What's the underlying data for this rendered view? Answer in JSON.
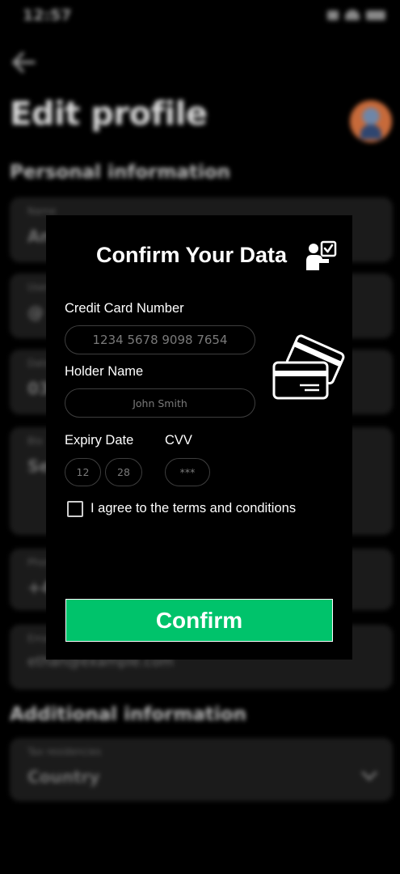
{
  "background": {
    "status_time": "12:57",
    "page_title": "Edit profile",
    "personal_section": "Personal information",
    "fields": [
      {
        "label": "Name",
        "value": "An"
      },
      {
        "label": "Username",
        "value": "@"
      },
      {
        "label": "Date",
        "value": "03"
      },
      {
        "label": "Bio",
        "value": "Se"
      },
      {
        "label": "Phone",
        "value": "+4"
      },
      {
        "label": "Email",
        "value": "ethan@example.com"
      }
    ],
    "additional_section": "Additional information",
    "tax_field": {
      "label": "Tax residencies",
      "value": "Country"
    }
  },
  "modal": {
    "title": "Confirm Your Data",
    "card_number": {
      "label": "Credit Card Number",
      "placeholder": "1234 5678 9098 7654"
    },
    "holder": {
      "label": "Holder Name",
      "placeholder": "John Smith"
    },
    "expiry": {
      "label": "Expiry Date",
      "month": "12",
      "year": "28"
    },
    "cvv": {
      "label": "CVV",
      "placeholder": "***"
    },
    "terms_label": "I agree to the terms and conditions",
    "confirm_label": "Confirm"
  },
  "colors": {
    "accent": "#00c36b",
    "modal_bg": "#000000",
    "field_bg": "#1b1b1b"
  },
  "icons": [
    "back-arrow-icon",
    "user-check-icon",
    "credit-cards-icon",
    "chevron-down-icon",
    "signal-icon",
    "wifi-icon",
    "battery-icon"
  ]
}
